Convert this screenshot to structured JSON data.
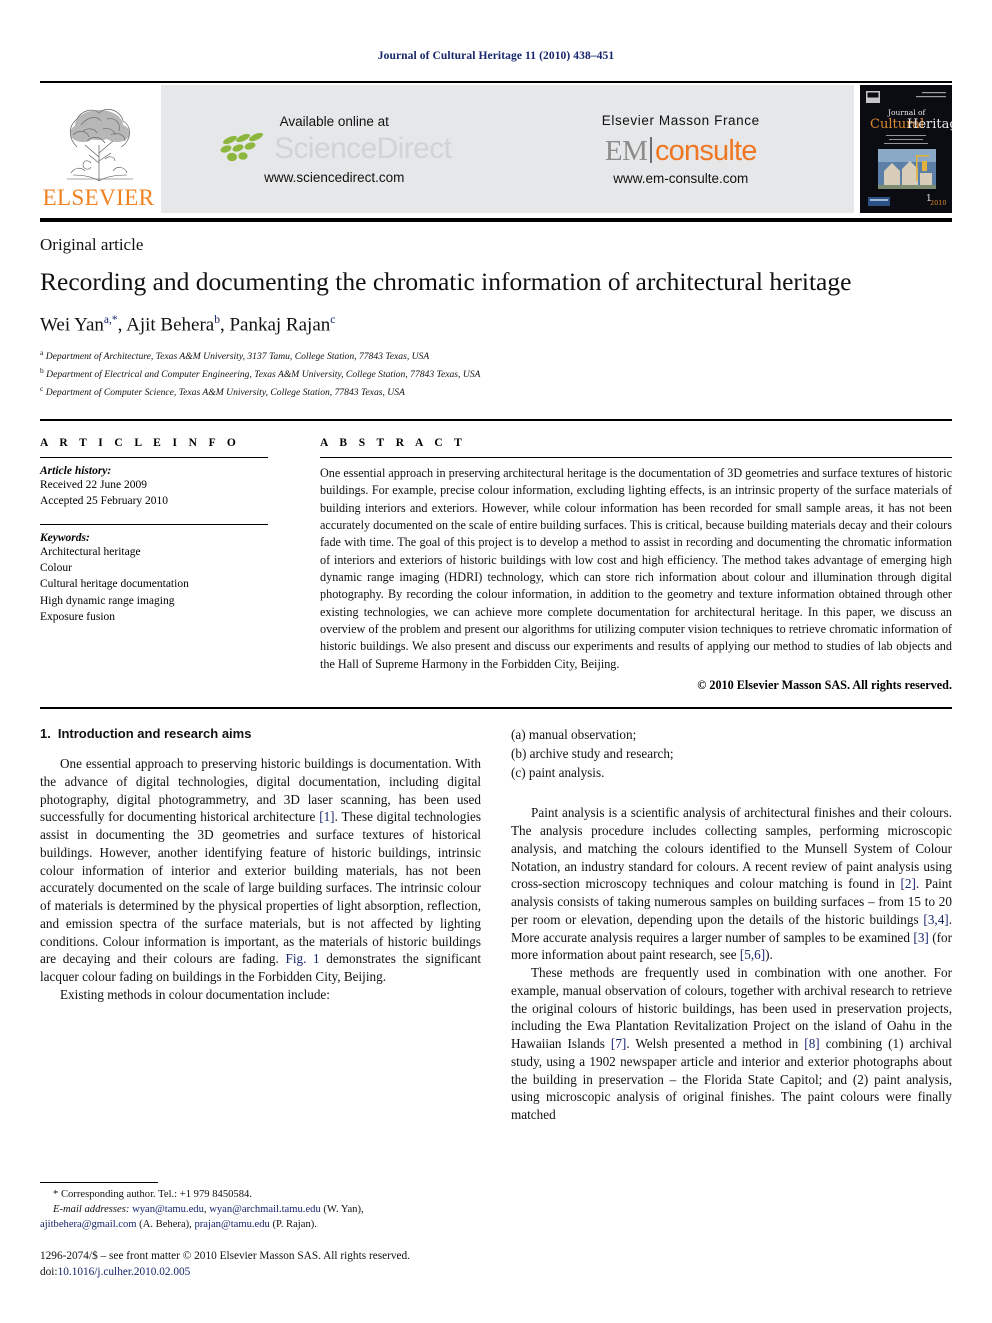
{
  "running_head": "Journal of Cultural Heritage 11 (2010) 438–451",
  "banner": {
    "elsevier_wordmark": "ELSEVIER",
    "sciencedirect": {
      "available_text": "Available online at",
      "logo_text": "ScienceDirect",
      "url": "www.sciencedirect.com"
    },
    "em_consulte": {
      "publisher": "Elsevier Masson France",
      "logo_em": "EM",
      "logo_consulte": "consulte",
      "url": "www.em-consulte.com"
    },
    "cover": {
      "journal_of": "Journal of",
      "journal_name": "Cultural Heritage",
      "tagline_line1": "A Multidisciplinary Journal",
      "tagline_line2": "of Science and Technology",
      "tagline_line3": "for Conservation and Awareness",
      "issue": "1",
      "year": "2010"
    }
  },
  "article_type": "Original article",
  "title": "Recording and documenting the chromatic information of architectural heritage",
  "authors": [
    {
      "name": "Wei Yan",
      "sup": "a,*"
    },
    {
      "name": "Ajit Behera",
      "sup": "b"
    },
    {
      "name": "Pankaj Rajan",
      "sup": "c"
    }
  ],
  "affiliations": [
    {
      "marker": "a",
      "text": "Department of Architecture, Texas A&M University, 3137 Tamu, College Station, 77843 Texas, USA"
    },
    {
      "marker": "b",
      "text": "Department of Electrical and Computer Engineering, Texas A&M University, College Station, 77843 Texas, USA"
    },
    {
      "marker": "c",
      "text": "Department of Computer Science, Texas A&M University, College Station, 77843 Texas, USA"
    }
  ],
  "article_info": {
    "heading": "A R T I C L E   I N F O",
    "history_label": "Article history:",
    "received": "Received 22 June 2009",
    "accepted": "Accepted 25 February 2010",
    "keywords_label": "Keywords:",
    "keywords": [
      "Architectural heritage",
      "Colour",
      "Cultural heritage documentation",
      "High dynamic range imaging",
      "Exposure fusion"
    ]
  },
  "abstract": {
    "heading": "A B S T R A C T",
    "text": "One essential approach in preserving architectural heritage is the documentation of 3D geometries and surface textures of historic buildings. For example, precise colour information, excluding lighting effects, is an intrinsic property of the surface materials of building interiors and exteriors. However, while colour information has been recorded for small sample areas, it has not been accurately documented on the scale of entire building surfaces. This is critical, because building materials decay and their colours fade with time. The goal of this project is to develop a method to assist in recording and documenting the chromatic information of interiors and exteriors of historic buildings with low cost and high efficiency. The method takes advantage of emerging high dynamic range imaging (HDRI) technology, which can store rich information about colour and illumination through digital photography. By recording the colour information, in addition to the geometry and texture information obtained through other existing technologies, we can achieve more complete documentation for architectural heritage. In this paper, we discuss an overview of the problem and present our algorithms for utilizing computer vision techniques to retrieve chromatic information of historic buildings. We also present and discuss our experiments and results of applying our method to studies of lab objects and the Hall of Supreme Harmony in the Forbidden City, Beijing.",
    "copyright": "© 2010 Elsevier Masson SAS. All rights reserved."
  },
  "section": {
    "number": "1.",
    "title": "Introduction and research aims"
  },
  "left_column": {
    "para1_a": "One essential approach to preserving historic buildings is documentation. With the advance of digital technologies, digital documentation, including digital photography, digital photogrammetry, and 3D laser scanning, has been used successfully for documenting historical architecture ",
    "para1_cite1": "[1]",
    "para1_b": ". These digital technologies assist in documenting the 3D geometries and surface textures of historical buildings. However, another identifying feature of historic buildings, intrinsic colour information of interior and exterior building materials, has not been accurately documented on the scale of large building surfaces. The intrinsic colour of materials is determined by the physical properties of light absorption, reflection, and emission spectra of the surface materials, but is not affected by lighting conditions. Colour information is important, as the materials of historic buildings are decaying and their colours are fading. ",
    "para1_cite2": "Fig. 1",
    "para1_c": " demonstrates the significant lacquer colour fading on buildings in the Forbidden City, Beijing.",
    "para2": "Existing methods in colour documentation include:"
  },
  "right_column": {
    "list": [
      "(a) manual observation;",
      "(b) archive study and research;",
      "(c) paint analysis."
    ],
    "para1_a": "Paint analysis is a scientific analysis of architectural finishes and their colours. The analysis procedure includes collecting samples, performing microscopic analysis, and matching the colours identified to the Munsell System of Colour Notation, an industry standard for colours. A recent review of paint analysis using cross-section microscopy techniques and colour matching is found in ",
    "para1_cite1": "[2]",
    "para1_b": ". Paint analysis consists of taking numerous samples on building surfaces – from 15 to 20 per room or elevation, depending upon the details of the historic buildings ",
    "para1_cite2": "[3,4]",
    "para1_c": ". More accurate analysis requires a larger number of samples to be examined ",
    "para1_cite3": "[3]",
    "para1_d": " (for more information about paint research, see ",
    "para1_cite4": "[5,6]",
    "para1_e": ").",
    "para2_a": "These methods are frequently used in combination with one another. For example, manual observation of colours, together with archival research to retrieve the original colours of historic buildings, has been used in preservation projects, including the Ewa Plantation Revitalization Project on the island of Oahu in the Hawaiian Islands ",
    "para2_cite1": "[7]",
    "para2_b": ". Welsh presented a method in ",
    "para2_cite2": "[8]",
    "para2_c": " combining (1) archival study, using a 1902 newspaper article and interior and exterior photographs about the building in preservation – the Florida State Capitol; and (2) paint analysis, using microscopic analysis of original finishes. The paint colours were finally matched"
  },
  "footnote": {
    "corresponding": "* Corresponding author. Tel.: +1 979 8450584.",
    "email_label": "E-mail addresses:",
    "email1": "wyan@tamu.edu",
    "email1_sep": ", ",
    "email2": "wyan@archmail.tamu.edu",
    "email2_suffix": " (W. Yan),",
    "email3": "ajitbehera@gmail.com",
    "email3_suffix": " (A. Behera), ",
    "email4": "prajan@tamu.edu",
    "email4_suffix": " (P. Rajan)."
  },
  "imprint": {
    "line1": "1296-2074/$ – see front matter © 2010 Elsevier Masson SAS. All rights reserved.",
    "doi_prefix": "doi:",
    "doi": "10.1016/j.culher.2010.02.005"
  },
  "colors": {
    "link_blue": "#17256b",
    "elsevier_orange": "#f08221",
    "consulte_orange": "#ef7622",
    "banner_gray": "#e6e7e8",
    "sciencedirect_gray": "#d2d3d5",
    "cover_dark": "#0b0b12"
  }
}
